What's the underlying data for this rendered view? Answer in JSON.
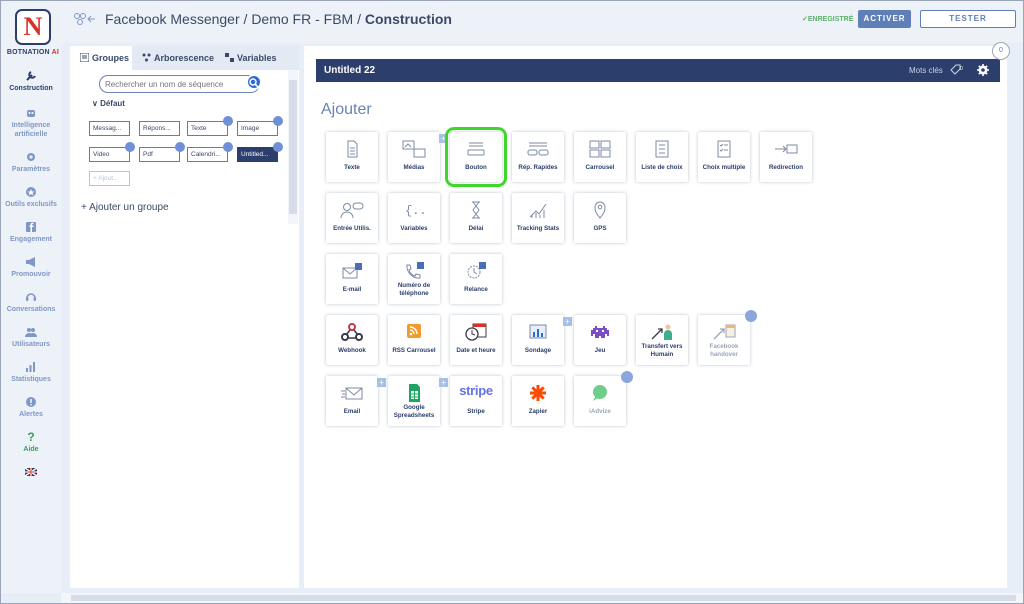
{
  "logo": {
    "letter": "N",
    "brand_a": "BOTNATION",
    "brand_b": " AI"
  },
  "nav": [
    {
      "label": "Construction",
      "icon": "wrench-icon"
    },
    {
      "label": "Intelligence artificielle",
      "icon": "robot-icon"
    },
    {
      "label": "Paramètres",
      "icon": "gear-icon"
    },
    {
      "label": "Outils exclusifs",
      "icon": "star-icon"
    },
    {
      "label": "Engagement",
      "icon": "facebook-icon"
    },
    {
      "label": "Promouvoir",
      "icon": "megaphone-icon"
    },
    {
      "label": "Conversations",
      "icon": "headset-icon"
    },
    {
      "label": "Utilisateurs",
      "icon": "users-icon"
    },
    {
      "label": "Statistiques",
      "icon": "chart-icon"
    },
    {
      "label": "Alertes",
      "icon": "alert-icon"
    },
    {
      "label": "Aide",
      "icon": "help-icon"
    },
    {
      "label": "",
      "icon": "uk-flag-icon"
    }
  ],
  "header": {
    "crumb1": "Facebook Messenger",
    "sep1": " / ",
    "crumb2": "Demo FR - FBM",
    "sep2": " / ",
    "crumb3": "Construction",
    "saved": "ENREGISTRÉ",
    "activate": "ACTIVER",
    "test": "TESTER"
  },
  "sidebar": {
    "tabs": [
      "Groupes",
      "Arborescence",
      "Variables"
    ],
    "search_placeholder": "Rechercher un nom de séquence",
    "group_name": "Défaut",
    "sequences": [
      "Messag...",
      "Répons...",
      "Texte",
      "Image",
      "Video",
      "Pdf",
      "Calendri...",
      "Untitled..."
    ],
    "add_sequence": "Ajout...",
    "add_group": "Ajouter un groupe"
  },
  "main": {
    "title": "Untitled 22",
    "keywords_label": "Mots clés",
    "keywords_count": "0",
    "counter": "0",
    "add_heading": "Ajouter",
    "cards": [
      {
        "label": "Texte",
        "icon": "document-icon"
      },
      {
        "label": "Médias",
        "icon": "media-icon",
        "plus": "+"
      },
      {
        "label": "Bouton",
        "icon": "button-icon"
      },
      {
        "label": "Rép. Rapides",
        "icon": "quick-replies-icon"
      },
      {
        "label": "Carrousel",
        "icon": "carousel-icon"
      },
      {
        "label": "Liste de choix",
        "icon": "list-icon"
      },
      {
        "label": "Choix multiple",
        "icon": "multi-choice-icon"
      },
      {
        "label": "Redirection",
        "icon": "redirect-icon"
      },
      {
        "label": "Entrée Utilis.",
        "icon": "user-input-icon"
      },
      {
        "label": "Variables",
        "icon": "variables-icon"
      },
      {
        "label": "Délai",
        "icon": "hourglass-icon"
      },
      {
        "label": "Tracking Stats",
        "icon": "tracking-icon"
      },
      {
        "label": "GPS",
        "icon": "gps-icon"
      },
      {
        "label": "E-mail",
        "icon": "email-fb-icon"
      },
      {
        "label": "Numéro de téléphone",
        "icon": "phone-fb-icon"
      },
      {
        "label": "Relance",
        "icon": "relance-fb-icon"
      },
      {
        "label": "Webhook",
        "icon": "webhook-icon"
      },
      {
        "label": "RSS Carrousel",
        "icon": "rss-icon"
      },
      {
        "label": "Date et heure",
        "icon": "calendar-clock-icon"
      },
      {
        "label": "Sondage",
        "icon": "poll-icon",
        "plus": "+"
      },
      {
        "label": "Jeu",
        "icon": "game-icon"
      },
      {
        "label": "Transfert vers Humain",
        "icon": "human-transfer-icon"
      },
      {
        "label": "Facebook handover",
        "icon": "handover-icon",
        "lock": true
      },
      {
        "label": "Email",
        "icon": "email-icon",
        "plus": "+"
      },
      {
        "label": "Google Spreadsheets",
        "icon": "sheets-icon",
        "plus": "+"
      },
      {
        "label": "Stripe",
        "icon": "stripe-icon"
      },
      {
        "label": "Zapier",
        "icon": "zapier-icon"
      },
      {
        "label": "iAdvize",
        "icon": "iadvize-icon",
        "lock": true
      }
    ],
    "stripe_word": "stripe"
  },
  "colors": {
    "brand_dark": "#2c3e6b",
    "accent": "#5f7fb8",
    "selected_outline": "#3fd62b",
    "logo_red": "#d8332a"
  }
}
